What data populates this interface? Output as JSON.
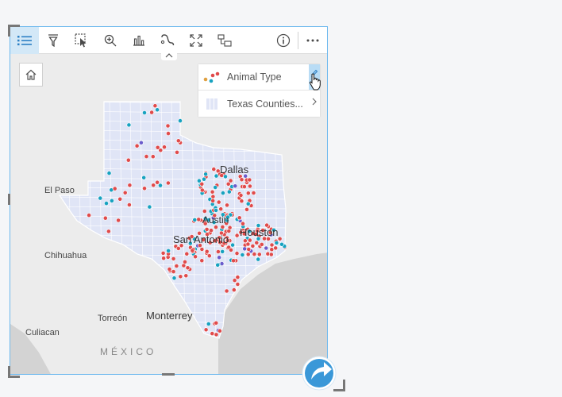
{
  "toolbar": {
    "buttons": [
      {
        "name": "legend-list-icon",
        "active": true
      },
      {
        "name": "filter-icon"
      },
      {
        "name": "select-cursor-icon"
      },
      {
        "name": "zoom-icon"
      },
      {
        "name": "bar-chart-icon"
      },
      {
        "name": "link-icon"
      },
      {
        "name": "expand-icon"
      },
      {
        "name": "visualization-type-icon"
      }
    ],
    "right_buttons": [
      {
        "name": "info-icon"
      },
      {
        "name": "more-icon"
      }
    ]
  },
  "legend": {
    "layer1_label": "Animal Type",
    "layer2_label": "Texas Counties..."
  },
  "map_labels": {
    "dallas": "Dallas",
    "el_paso": "El Paso",
    "austin": "Austin",
    "san_antonio": "San Antonio",
    "houston": "Houston",
    "chihuahua": "Chihuahua",
    "torreon": "Torreón",
    "monterrey": "Monterrey",
    "culiacan": "Culiacan",
    "mexico": "MÉXICO"
  },
  "colors": {
    "accent": "#6cb8ee",
    "point_red": "#e04b4b",
    "point_teal": "#17a2c0",
    "point_purple": "#6b5ccc",
    "texas_fill": "#e0e5f6",
    "water": "#d3d3d3"
  }
}
